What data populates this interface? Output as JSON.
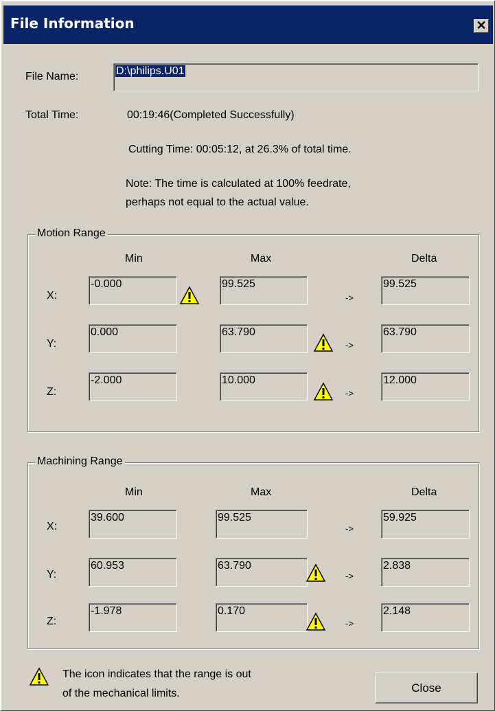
{
  "window": {
    "title": "File Information",
    "close_glyph": "✕"
  },
  "file": {
    "name_label": "File Name:",
    "name_value": "D:\\philips.U01",
    "total_time_label": "Total Time:",
    "total_time_value": "00:19:46(Completed Successfully)",
    "cutting_time": "Cutting Time: 00:05:12, at 26.3% of total time.",
    "note_line1": "Note: The time is calculated at 100% feedrate,",
    "note_line2": "perhaps not equal to the actual value."
  },
  "motion_range": {
    "title": "Motion Range",
    "headers": {
      "min": "Min",
      "max": "Max",
      "delta": "Delta"
    },
    "rows": [
      {
        "axis": "X:",
        "min": "-0.000",
        "max": "99.525",
        "arrow": "->",
        "delta": "99.525",
        "warn_min": true,
        "warn_max": false
      },
      {
        "axis": "Y:",
        "min": "0.000",
        "max": "63.790",
        "arrow": "->",
        "delta": "63.790",
        "warn_min": false,
        "warn_max": true
      },
      {
        "axis": "Z:",
        "min": "-2.000",
        "max": "10.000",
        "arrow": "->",
        "delta": "12.000",
        "warn_min": false,
        "warn_max": true
      }
    ]
  },
  "machining_range": {
    "title": "Machining Range",
    "headers": {
      "min": "Min",
      "max": "Max",
      "delta": "Delta"
    },
    "rows": [
      {
        "axis": "X:",
        "min": "39.600",
        "max": "99.525",
        "arrow": "->",
        "delta": "59.925",
        "warn_min": false,
        "warn_max": false
      },
      {
        "axis": "Y:",
        "min": "60.953",
        "max": "63.790",
        "arrow": "->",
        "delta": "2.838",
        "warn_min": false,
        "warn_max": true
      },
      {
        "axis": "Z:",
        "min": "-1.978",
        "max": "0.170",
        "arrow": "->",
        "delta": "2.148",
        "warn_min": false,
        "warn_max": true
      }
    ]
  },
  "footer": {
    "legend_line1": "The icon indicates that the range is out",
    "legend_line2": "of the mechanical limits.",
    "close_label": "Close"
  },
  "colors": {
    "titlebar": "#0a246a",
    "face": "#d4d0c8",
    "warning": "#ffff00"
  }
}
